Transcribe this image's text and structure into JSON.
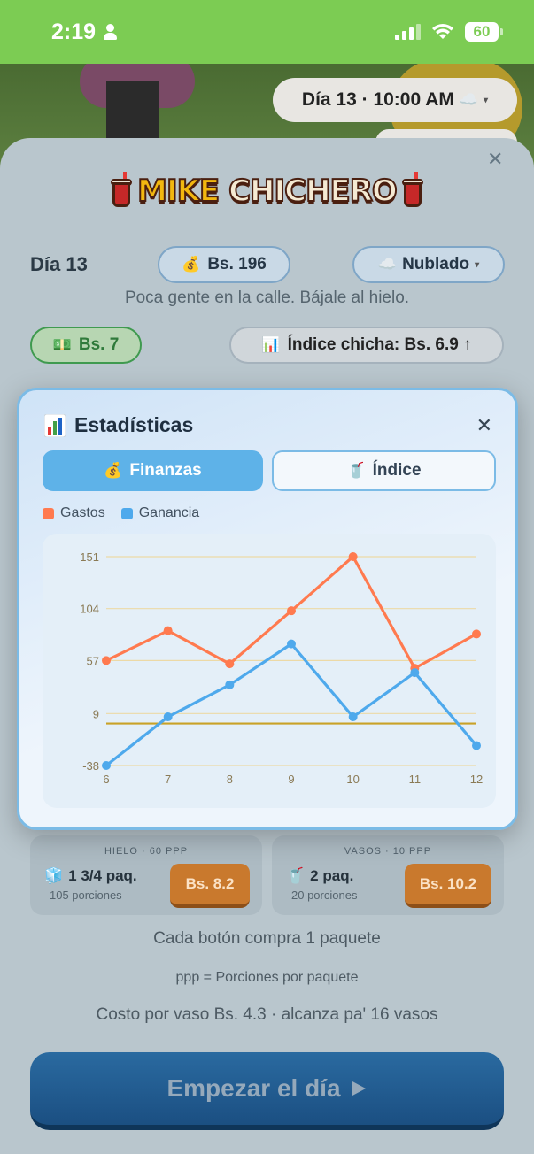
{
  "status_bar": {
    "time": "2:19",
    "battery": "60"
  },
  "top_pill": {
    "label": "Día 13 · 10:00 AM",
    "icon": "cloud-icon"
  },
  "header": {
    "logo_word1": "MIKE",
    "logo_word2": "CHICHERO",
    "day": "Día 13",
    "money": "Bs. 196",
    "weather": "Nublado",
    "hint": "Poca gente en la calle. Bájale al hielo.",
    "cash": "Bs. 7",
    "index": "Índice chicha: Bs. 6.9 ↑"
  },
  "stats_modal": {
    "title": "Estadísticas",
    "tabs": [
      {
        "label": "Finanzas",
        "active": true,
        "icon": "money-bag-icon"
      },
      {
        "label": "Índice",
        "active": false,
        "icon": "cup-icon"
      }
    ],
    "legend": [
      {
        "label": "Gastos",
        "color": "#ff7a4f"
      },
      {
        "label": "Ganancia",
        "color": "#4ea9ec"
      }
    ]
  },
  "chart_data": {
    "type": "line",
    "x": [
      6,
      7,
      8,
      9,
      10,
      11,
      12
    ],
    "series": [
      {
        "name": "Gastos",
        "color": "#ff7a4f",
        "values": [
          57,
          84,
          54,
          102,
          151,
          50,
          81
        ]
      },
      {
        "name": "Ganancia",
        "color": "#4ea9ec",
        "values": [
          -38,
          6,
          35,
          72,
          6,
          46,
          -20
        ]
      }
    ],
    "yticks": [
      151,
      104,
      57,
      9,
      -38
    ],
    "ylim": [
      -38,
      151
    ],
    "reference_line": 0,
    "reference_color": "#c9a227",
    "grid": true,
    "legend_position": "top-left"
  },
  "supplies": [
    {
      "title": "HIELO · 60 PPP",
      "amount": "1 3/4 paq.",
      "portions": "105 porciones",
      "price": "Bs. 8.2",
      "icon": "ice-icon"
    },
    {
      "title": "VASOS · 10 PPP",
      "amount": "2 paq.",
      "portions": "20 porciones",
      "price": "Bs. 10.2",
      "icon": "cup-icon"
    }
  ],
  "footer": {
    "note1": "Cada botón compra 1 paquete",
    "note2": "ppp = Porciones por paquete",
    "note3": "Costo por vaso Bs. 4.3 · alcanza pa' 16 vasos",
    "start_label": "Empezar el día"
  }
}
